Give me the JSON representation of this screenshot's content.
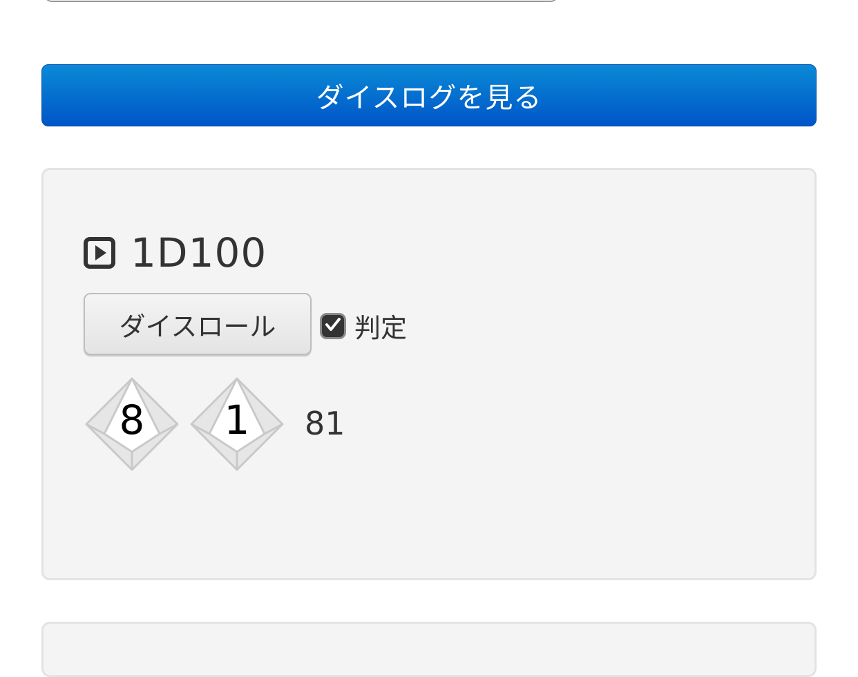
{
  "header_button": {
    "label": "ダイスログを見る"
  },
  "dice_card": {
    "title": "1D100",
    "roll_button_label": "ダイスロール",
    "judge": {
      "label": "判定",
      "checked": true
    },
    "dice": [
      {
        "value": "8"
      },
      {
        "value": "1"
      }
    ],
    "total": "81"
  },
  "colors": {
    "primary_gradient_top": "#0a8ad6",
    "primary_gradient_bottom": "#0055c8",
    "card_background": "#f4f4f4"
  },
  "icons": {
    "title": "play-square-icon",
    "checkbox": "check-icon",
    "die": "d10-die-icon"
  }
}
